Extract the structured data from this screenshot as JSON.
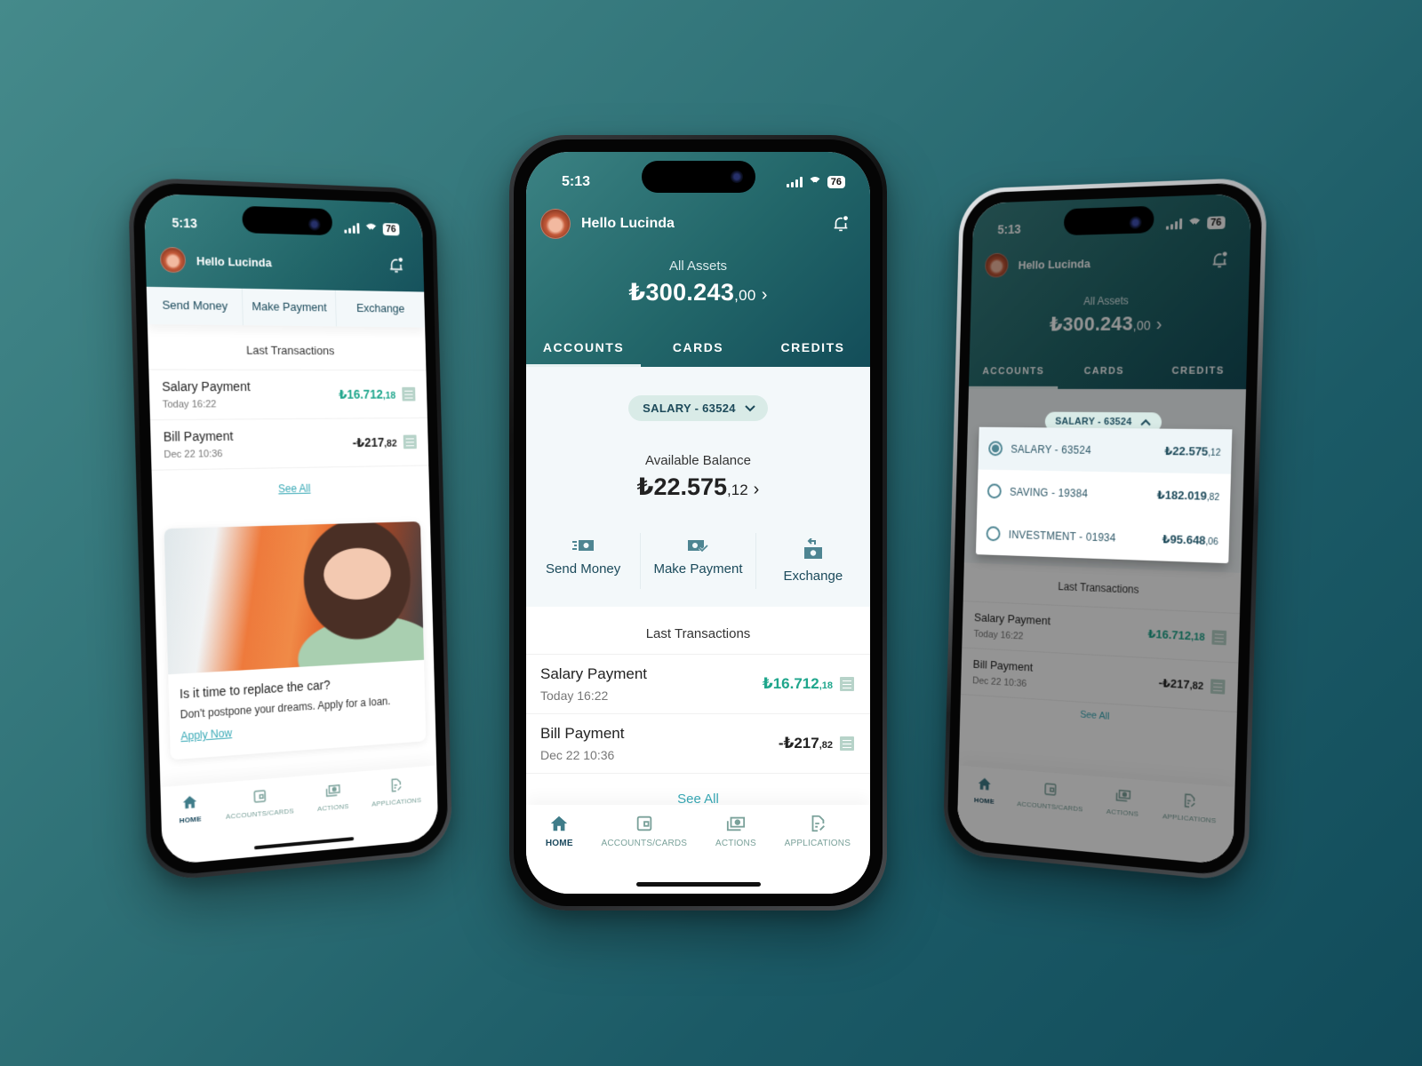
{
  "colors": {
    "brand_teal": "#226669",
    "positive": "#1fa68c",
    "link": "#38a9b6",
    "text_dark_blue": "#1b4a5b",
    "pill_bg": "#d9ebe7"
  },
  "status_bar": {
    "time": "5:13",
    "battery": "76"
  },
  "user": {
    "greeting": "Hello Lucinda"
  },
  "assets": {
    "label": "All Assets",
    "currency": "₺",
    "whole": "300.243",
    "decimals": ",00"
  },
  "tabs": [
    {
      "label": "ACCOUNTS",
      "active": true
    },
    {
      "label": "CARDS",
      "active": false
    },
    {
      "label": "CREDITS",
      "active": false
    }
  ],
  "account": {
    "selected": "SALARY - 63524",
    "available_label": "Available Balance",
    "currency": "₺",
    "whole": "22.575",
    "decimals": ",12"
  },
  "actions": [
    {
      "label": "Send Money",
      "icon": "send-money-icon"
    },
    {
      "label": "Make Payment",
      "icon": "make-payment-icon"
    },
    {
      "label": "Exchange",
      "icon": "exchange-icon"
    }
  ],
  "transactions": {
    "title": "Last Transactions",
    "items": [
      {
        "name": "Salary Payment",
        "date": "Today 16:22",
        "amount": "₺16.712",
        "decimals": ",18",
        "positive": true
      },
      {
        "name": "Bill Payment",
        "date": "Dec 22 10:36",
        "amount": "-₺217",
        "decimals": ",82",
        "positive": false
      }
    ],
    "see_all": "See All"
  },
  "promo": {
    "title": "Is it time to replace the car?",
    "text": "Don't postpone your dreams. Apply for a loan.",
    "cta": "Apply Now"
  },
  "account_dropdown": {
    "items": [
      {
        "name": "SALARY - 63524",
        "amount": "₺22.575",
        "decimals": ",12",
        "selected": true
      },
      {
        "name": "SAVING - 19384",
        "amount": "₺182.019",
        "decimals": ",82",
        "selected": false
      },
      {
        "name": "INVESTMENT - 01934",
        "amount": "₺95.648",
        "decimals": ",06",
        "selected": false
      }
    ]
  },
  "bottom_nav": [
    {
      "label": "HOME",
      "icon": "home-icon",
      "active": true
    },
    {
      "label": "ACCOUNTS/CARDS",
      "icon": "wallet-icon",
      "active": false
    },
    {
      "label": "ACTIONS",
      "icon": "cash-icon",
      "active": false
    },
    {
      "label": "APPLICATIONS",
      "icon": "document-edit-icon",
      "active": false
    }
  ]
}
